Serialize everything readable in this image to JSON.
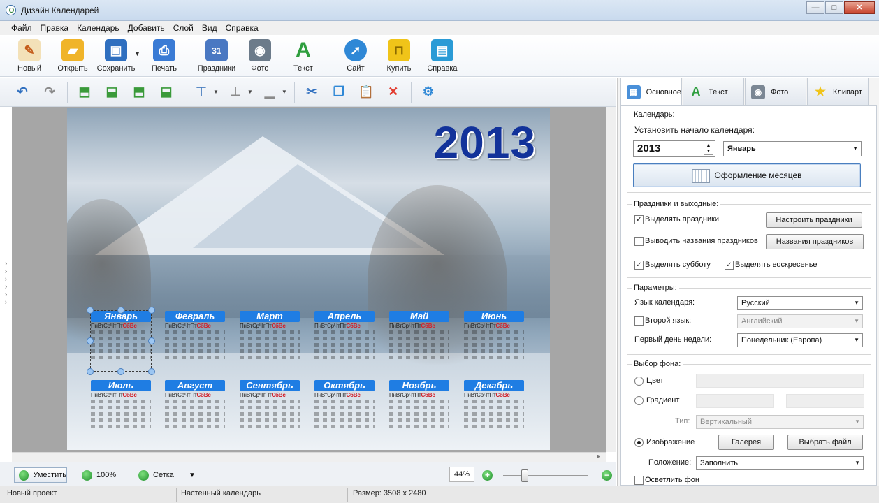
{
  "window": {
    "title": "Дизайн Календарей"
  },
  "menu": [
    "Файл",
    "Правка",
    "Календарь",
    "Добавить",
    "Слой",
    "Вид",
    "Справка"
  ],
  "toolbar": [
    {
      "label": "Новый",
      "icon": "new-document-icon",
      "color": "#e6a23c"
    },
    {
      "label": "Открыть",
      "icon": "folder-open-icon",
      "color": "#f0b429"
    },
    {
      "label": "Сохранить",
      "icon": "floppy-disk-icon",
      "color": "#2f6fbf"
    },
    {
      "label": "Печать",
      "icon": "printer-icon",
      "color": "#3a7bd5"
    },
    {
      "label": "Праздники",
      "icon": "calendar-icon",
      "color": "#4a78c2"
    },
    {
      "label": "Фото",
      "icon": "camera-icon",
      "color": "#6c7b8a"
    },
    {
      "label": "Текст",
      "icon": "text-a-icon",
      "color": "#2e9e3e"
    },
    {
      "label": "Сайт",
      "icon": "globe-icon",
      "color": "#2f88d6"
    },
    {
      "label": "Купить",
      "icon": "shopping-bag-icon",
      "color": "#f0c419"
    },
    {
      "label": "Справка",
      "icon": "help-book-icon",
      "color": "#2a9bd6"
    }
  ],
  "calendar": {
    "year": "2013",
    "months": [
      "Январь",
      "Февраль",
      "Март",
      "Апрель",
      "Май",
      "Июнь",
      "Июль",
      "Август",
      "Сентябрь",
      "Октябрь",
      "Ноябрь",
      "Декабрь"
    ],
    "weekdays_regular": "ПнВтСрЧтПт",
    "weekdays_weekend": "СбВс"
  },
  "panel": {
    "tabs": [
      "Основное",
      "Текст",
      "Фото",
      "Клипарт"
    ],
    "calendar_group": {
      "title": "Календарь:",
      "start_label": "Установить начало календаря:",
      "year_value": "2013",
      "month_value": "Январь",
      "months_button": "Оформление месяцев"
    },
    "holidays_group": {
      "title": "Праздники и выходные:",
      "highlight_holidays": "Выделять праздники",
      "setup_holidays": "Настроить праздники",
      "show_holiday_names": "Выводить названия праздников",
      "holiday_names": "Названия праздников",
      "highlight_saturday": "Выделять субботу",
      "highlight_sunday": "Выделять воскресенье"
    },
    "params_group": {
      "title": "Параметры:",
      "language_label": "Язык календаря:",
      "language_value": "Русский",
      "second_language_label": "Второй язык:",
      "second_language_value": "Английский",
      "first_day_label": "Первый день недели:",
      "first_day_value": "Понедельник (Европа)"
    },
    "background_group": {
      "title": "Выбор фона:",
      "color_label": "Цвет",
      "gradient_label": "Градиент",
      "type_label": "Тип:",
      "type_value": "Вертикальный",
      "image_label": "Изображение",
      "gallery_button": "Галерея",
      "choose_file_button": "Выбрать файл",
      "position_label": "Положение:",
      "position_value": "Заполнить",
      "lighten_label": "Осветлить фон"
    }
  },
  "bottom": {
    "fit_label": "Уместить",
    "zoom100_label": "100%",
    "grid_label": "Сетка",
    "zoom_value": "44%",
    "zoom_slider_fraction": 0.25
  },
  "status": {
    "project": "Новый проект",
    "type": "Настенный календарь",
    "size": "Размер: 3508 x 2480"
  }
}
